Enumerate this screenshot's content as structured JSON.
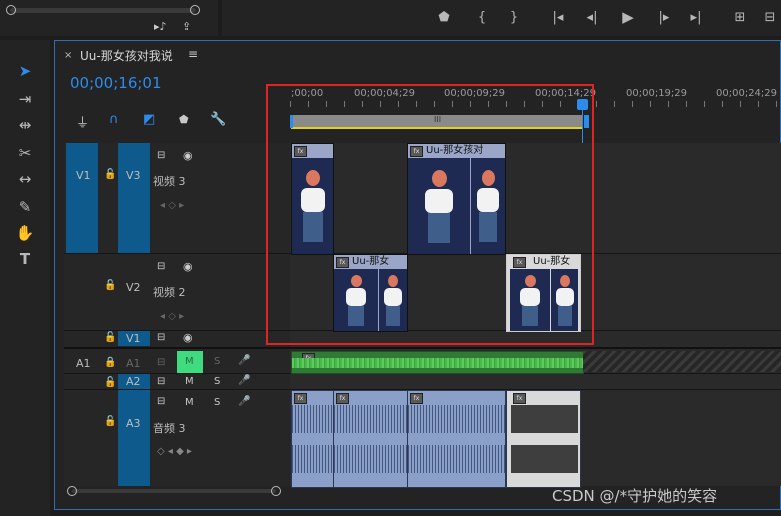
{
  "sequence": {
    "tab_title": "Uu-那女孩对我说",
    "timecode": "00;00;16;01"
  },
  "ruler": {
    "ticks": [
      ";00;00",
      "00;00;04;29",
      "00;00;09;29",
      "00;00;14;29",
      "00;00;19;29",
      "00;00;24;29"
    ]
  },
  "tracks": {
    "v3": {
      "target": "V1",
      "id": "V3",
      "name": "视频 3"
    },
    "v2": {
      "id": "V2",
      "name": "视频 2"
    },
    "v1": {
      "id": "V1"
    },
    "a1": {
      "source": "A1",
      "id": "A1",
      "mute": "M",
      "solo": "S"
    },
    "a2": {
      "id": "A2",
      "mute": "M",
      "solo": "S"
    },
    "a3": {
      "id": "A3",
      "name": "音频 3",
      "mute": "M",
      "solo": "S"
    }
  },
  "clips": {
    "v3_clip2": "Uu-那女孩对",
    "v2_clip1": "Uu-那女",
    "v2_clip2": "Uu-那女"
  },
  "fx_label": "fx",
  "watermark": "CSDN @/*守护她的笑容",
  "colors": {
    "accent_blue": "#2d8ceb",
    "track_blue": "#0f5a8c",
    "selection_red": "#e02424",
    "audio_green": "#3fa33f",
    "playhead": "#2d8ceb"
  }
}
